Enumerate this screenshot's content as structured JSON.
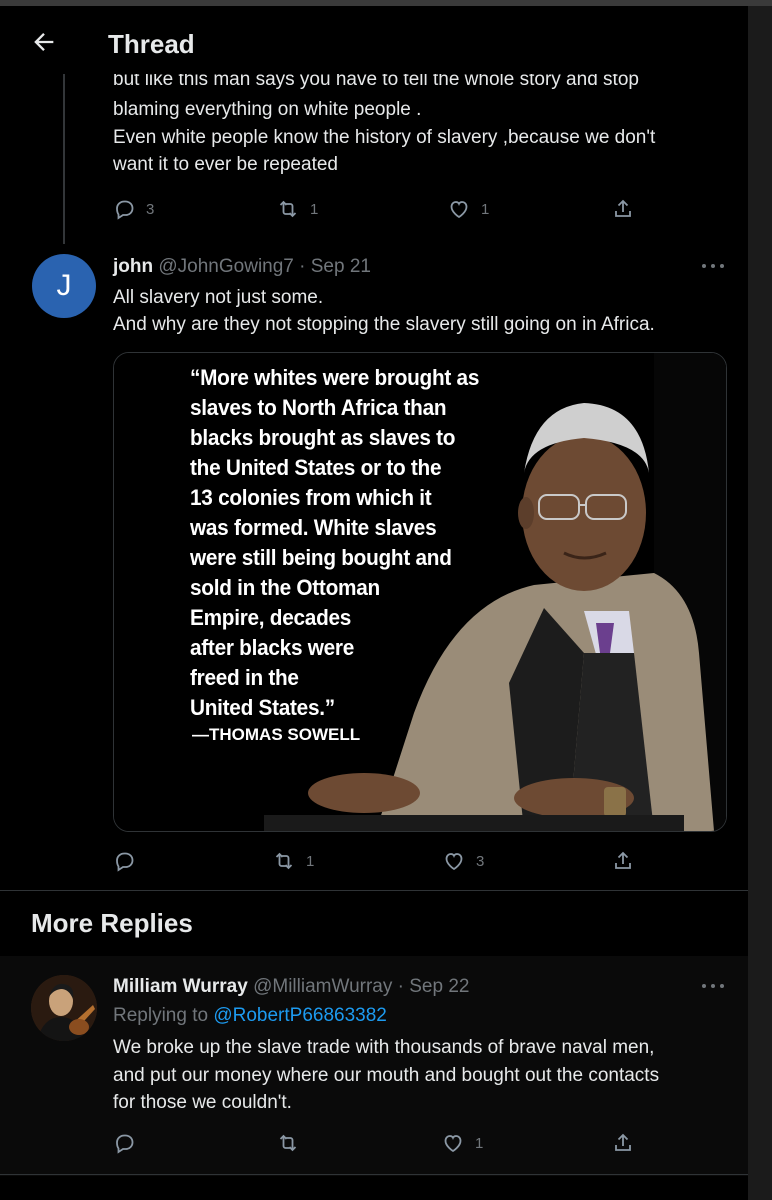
{
  "header": {
    "title": "Thread"
  },
  "parent_tweet": {
    "lines": [
      "but like this man says you have to tell the whole story and stop",
      "blaming everything on white people .",
      "Even white people know the history of slavery ,because we don't",
      "want it to ever be repeated"
    ],
    "replies": "3",
    "retweets": "1",
    "likes": "1"
  },
  "tweet": {
    "avatar_letter": "J",
    "name": "john",
    "handle": "@JohnGowing7",
    "time": " · Sep 21",
    "lines": [
      "All slavery not just some.",
      "And why are they not stopping the slavery still going on in Africa."
    ],
    "image": {
      "quote_lines": [
        "“More whites were brought as",
        "slaves to North Africa than",
        "blacks brought as slaves to",
        "the United States or to the",
        "13 colonies from which it",
        "was formed. White slaves",
        "were still being bought and",
        "sold in the Ottoman",
        "Empire, decades",
        "after blacks were",
        "freed in the",
        "United States.”"
      ],
      "attribution": "—THOMAS SOWELL"
    },
    "retweets": "1",
    "likes": "3"
  },
  "more_replies": {
    "title": "More Replies"
  },
  "reply": {
    "name": "Milliam Wurray",
    "handle": "@MilliamWurray",
    "time": " · Sep 22",
    "replying_to_label": "Replying to ",
    "replying_to_handle": "@RobertP66863382",
    "lines": [
      "We broke up the slave trade with thousands of brave naval men,",
      "and put our money where our mouth and bought out the contacts",
      "for those we couldn't."
    ],
    "likes": "1"
  },
  "colors": {
    "background": "#000000",
    "text": "#e7e9ea",
    "muted": "#71767b",
    "link": "#1d9bf0",
    "avatar_j": "#2a63b0"
  }
}
